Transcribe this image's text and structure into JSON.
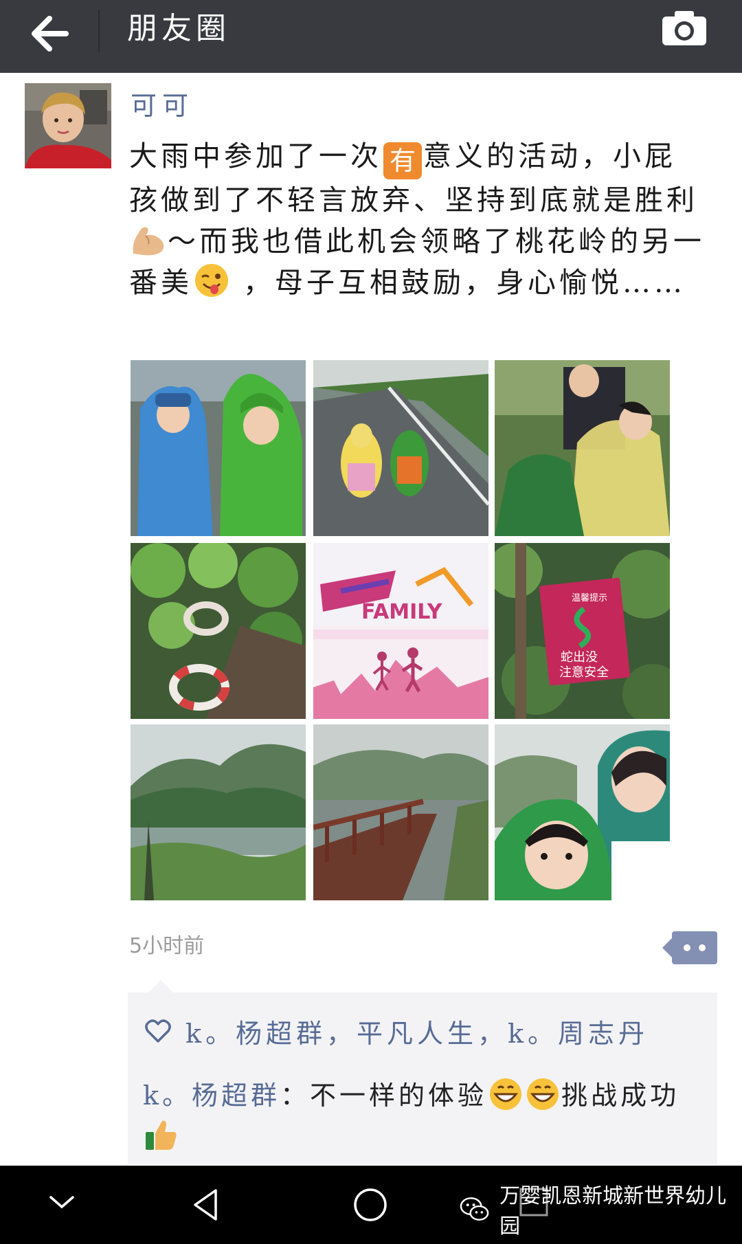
{
  "header": {
    "title": "朋友圈",
    "back_icon": "arrow-left-icon",
    "camera_icon": "camera-icon"
  },
  "post": {
    "author": "可可",
    "text_part1": "大雨中参加了一次",
    "text_you": "有",
    "text_part2": "意义的活动，小屁孩做到了不轻言放弃、坚持到底就是胜利",
    "text_part3": "～而我也借此机会领略了桃花岭的另一番美",
    "text_part4": " ，母子互相鼓励，身心愉悦……",
    "timestamp": "5小时前",
    "photos": [
      "kids-in-raincoats",
      "kids-on-wet-path",
      "mother-helping-child",
      "ivy-and-lifebuoys",
      "family-run-poster",
      "snake-warning-sign",
      "misty-lake-hills",
      "lakeside-boardwalk",
      "selfie-mother-child"
    ],
    "poster_text": "FAMILY",
    "sign_lines": [
      "温馨提示",
      "蛇出没",
      "注意安全"
    ]
  },
  "social": {
    "likes": "k。杨超群，平凡人生，k。周志丹",
    "comment_author": "k。杨超群",
    "comment_sep": "：",
    "comment_text1": "不一样的体验",
    "comment_text2": "挑战成功"
  },
  "navbar": {
    "watermark": "万婴凯恩新城新世界幼儿园"
  },
  "colors": {
    "topbar": "#393a3f",
    "link": "#576b95",
    "social_bg": "#f3f3f5",
    "comment_button": "#8390b3"
  }
}
